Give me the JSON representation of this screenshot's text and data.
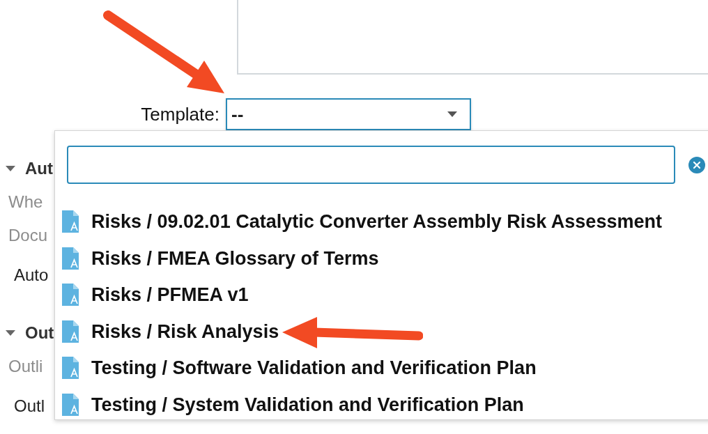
{
  "template": {
    "label": "Template:",
    "value": "--"
  },
  "sections": [
    {
      "title": "Aut",
      "expanded": true,
      "lines": [
        {
          "kind": "hint",
          "text": "Whe"
        },
        {
          "kind": "hint",
          "text": "Docu"
        },
        {
          "kind": "value",
          "text": "Auto"
        }
      ]
    },
    {
      "title": "Out",
      "expanded": true,
      "lines": [
        {
          "kind": "hint",
          "text": "Outli"
        },
        {
          "kind": "value",
          "text": "Outl"
        }
      ]
    }
  ],
  "dropdown": {
    "items": [
      {
        "label": "Risks / 09.02.01 Catalytic Converter Assembly Risk Assessment"
      },
      {
        "label": "Risks / FMEA Glossary of Terms"
      },
      {
        "label": "Risks / PFMEA v1"
      },
      {
        "label": "Risks / Risk Analysis"
      },
      {
        "label": "Testing / Software Validation and Verification Plan"
      },
      {
        "label": "Testing / System Validation and Verification Plan"
      }
    ]
  }
}
